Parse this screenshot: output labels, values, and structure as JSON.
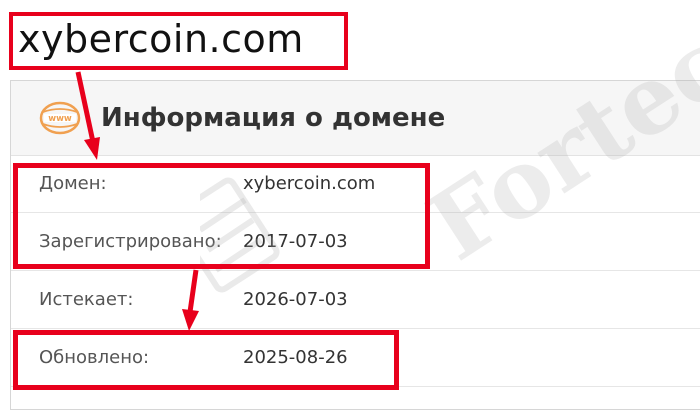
{
  "domain_label": "xybercoin.com",
  "card": {
    "title": "Информация о домене",
    "icon": "www-icon"
  },
  "rows": [
    {
      "label": "Домен:",
      "value": "xybercoin.com"
    },
    {
      "label": "Зарегистрировано:",
      "value": "2017-07-03"
    },
    {
      "label": "Истекает:",
      "value": "2026-07-03"
    },
    {
      "label": "Обновлено:",
      "value": "2025-08-26"
    }
  ],
  "watermark": "Forteck",
  "colors": {
    "highlight": "#e8001c",
    "icon_orange": "#f0a050"
  }
}
